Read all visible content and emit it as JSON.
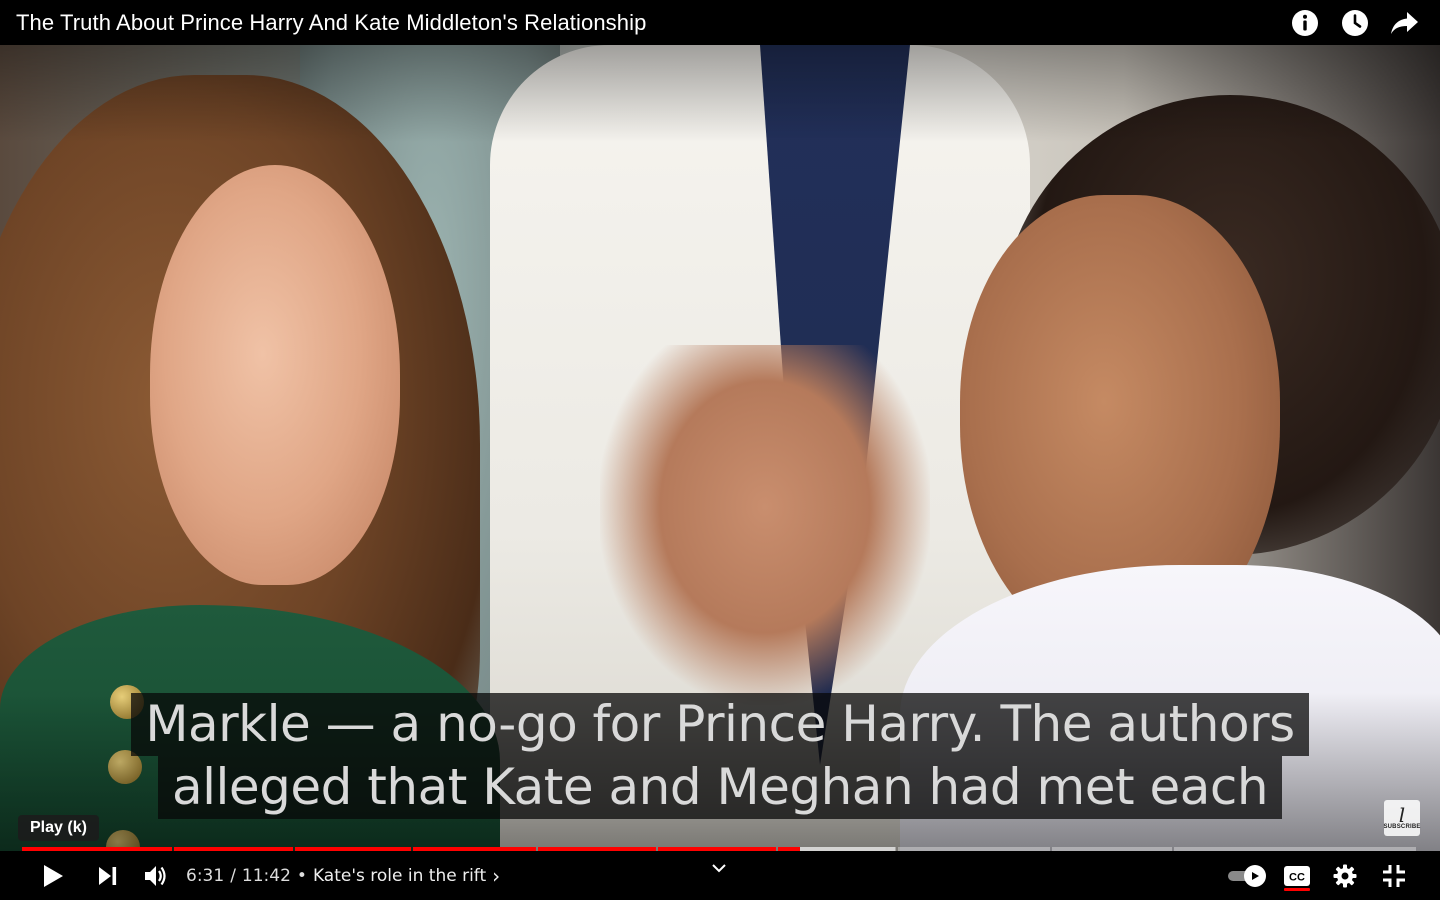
{
  "header": {
    "title": "The Truth About Prince Harry And Kate Middleton's Relationship",
    "icons": [
      "info-icon",
      "watch-later-icon",
      "share-icon"
    ]
  },
  "captions": {
    "line1": "Markle — a no-go for Prince Harry. The authors",
    "line2": "alleged that Kate and Meghan had met each"
  },
  "tooltip": {
    "text": "Play (k)"
  },
  "player": {
    "current_time": "6:31",
    "separator": "/",
    "duration": "11:42",
    "bullet": "•",
    "chapter_title": "Kate's role in the rift",
    "chapter_arrow": "›",
    "progress_fraction": 0.557,
    "accent_color": "#ff0000",
    "autoplay_on": true,
    "captions_on": true
  },
  "controls": {
    "left": [
      "play-icon",
      "next-icon",
      "volume-icon"
    ],
    "right": [
      "autoplay-toggle",
      "cc-icon",
      "settings-icon",
      "exit-fullscreen-icon"
    ]
  },
  "watermark": {
    "letter": "l",
    "text": "SUBSCRIBE"
  }
}
